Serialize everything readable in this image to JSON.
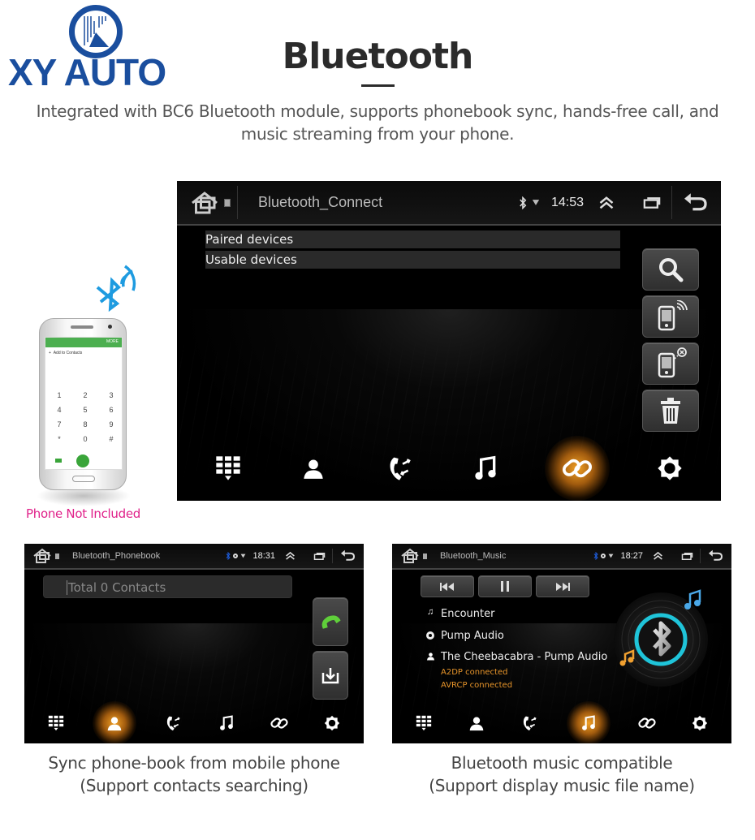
{
  "brand": {
    "logo_text": "XY AUTO",
    "logo_color": "#1a4e9e"
  },
  "header": {
    "title": "Bluetooth",
    "subtitle_line1": "Integrated with BC6 Bluetooth module, supports phonebook sync, hands-free call, and",
    "subtitle_line2": "music streaming from your phone."
  },
  "phone_illustration": {
    "bluetooth_icon": "bluetooth-signal-icon",
    "screen_action": "Add to Contacts",
    "screen_menu": "MORE",
    "keypad": [
      "1",
      "2",
      "3",
      "4",
      "5",
      "6",
      "7",
      "8",
      "9",
      "*",
      "0",
      "#"
    ],
    "note": "Phone Not Included",
    "note_color": "#e0218a"
  },
  "connect_screen": {
    "title": "Bluetooth_Connect",
    "time": "14:53",
    "list": [
      "Paired devices",
      "Usable devices"
    ],
    "side_buttons": [
      "search-icon",
      "phone-discoverable-icon",
      "phone-disconnect-icon",
      "trash-icon"
    ],
    "nav": [
      "dialpad",
      "contacts",
      "call-log",
      "music",
      "link",
      "settings"
    ],
    "active_nav": "link"
  },
  "phonebook_screen": {
    "title": "Bluetooth_Phonebook",
    "time": "18:31",
    "search_placeholder": "Total 0 Contacts",
    "side_buttons": [
      "call-icon",
      "download-contacts-icon"
    ],
    "active_nav": "contacts",
    "caption_line1": "Sync phone-book from mobile phone",
    "caption_line2": "(Support contacts searching)"
  },
  "music_screen": {
    "title": "Bluetooth_Music",
    "time": "18:27",
    "controls": [
      "previous",
      "pause",
      "next"
    ],
    "track": "Encounter",
    "album": "Pump Audio",
    "artist": "The Cheebacabra - Pump Audio",
    "status1": "A2DP connected",
    "status2": "AVRCP connected",
    "status_color": "#e8952a",
    "active_nav": "music",
    "caption_line1": "Bluetooth music compatible",
    "caption_line2": "(Support display music file name)"
  },
  "colors": {
    "active_glow": "#f5a623",
    "bluetooth_blue": "#1e9be0",
    "ring_cyan": "#1fc4d9"
  }
}
